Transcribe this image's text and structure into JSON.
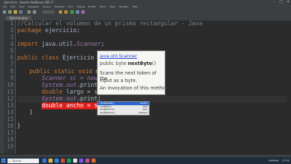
{
  "window": {
    "title": "Ejercicios - Apache NetBeans IDE 17"
  },
  "menu": [
    "File",
    "Edit",
    "View",
    "Navigate",
    "Source",
    "Refactor",
    "Run",
    "Debug",
    "Profile",
    "Team",
    "Tools",
    "Window",
    "Help"
  ],
  "editor": {
    "tab": "Ejercicio.java",
    "line_numbers": [
      "1",
      "2",
      "3",
      "4",
      "5",
      "6",
      "7",
      "8",
      "9",
      "10",
      "11",
      "12",
      "13",
      "14",
      "15",
      "16",
      "17",
      "18",
      "19",
      "20",
      "21"
    ],
    "lines": {
      "l1": "//Calcular el volumen de un prisma rectangular - Java",
      "l2_kw": "package",
      "l2_rest": " ejercicio;",
      "l4_kw": "import",
      "l4_pre": " java.util.",
      "l4_cls": "Scanner",
      "l4_end": ";",
      "l6_kw": "public class",
      "l6_cls": " Ejercicio",
      "l6_end": " {",
      "l8_kw": "public static void",
      "l8_rest": " ma",
      "l9": "Scanner sc = new",
      "l10_sys": "System.out",
      "l10_rest": ".print(",
      "l11_kw": "double",
      "l11_rest": " largo = sc",
      "l12_sys": "System.out",
      "l12_rest": ".print(",
      "l13_err": "double ancho = sc.",
      "l13_method": "nextd",
      "l14": "}",
      "l16": "}"
    }
  },
  "javadoc": {
    "header": "java.util.Scanner",
    "sig_mod": "public byte ",
    "sig_name": "nextByte",
    "sig_end": "()",
    "desc1": "Scans the next token of the",
    "desc2": "input as a byte.",
    "desc3": "An invocation of this method of"
  },
  "completion": {
    "items": [
      {
        "name": "nextDouble()",
        "type": "double"
      },
      {
        "name": "nextByte()",
        "type": "byte"
      },
      {
        "name": "nextByte(int)",
        "type": "byte"
      },
      {
        "name": "nextBoolean()",
        "type": "boolean"
      }
    ]
  },
  "taskbar": {
    "search": "Buscar",
    "time": "12:16",
    "weather": "Nublado"
  }
}
